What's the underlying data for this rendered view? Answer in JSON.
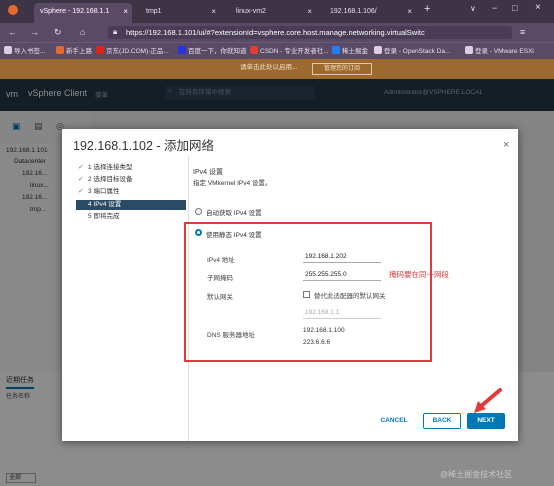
{
  "browser": {
    "tabs": [
      {
        "label": "vSphere - 192.168.1.1"
      },
      {
        "label": "tmp1"
      },
      {
        "label": "linux-vm2"
      },
      {
        "label": "192.168.1.106/"
      }
    ],
    "new_tab": "+",
    "url": "https://192.168.1.101/ui/#?extensionId=vsphere.core.host.manage.networking.virtualSwitc",
    "bookmarks": [
      {
        "label": "导入书签..."
      },
      {
        "label": "新手上路"
      },
      {
        "label": "京东(JD.COM)-正品..."
      },
      {
        "label": "百度一下，你就知道"
      },
      {
        "label": "CSDN - 专业开发者社..."
      },
      {
        "label": "稀土掘金"
      },
      {
        "label": "登录 - OpenStack Da..."
      },
      {
        "label": "登录 - VMware ESXi"
      }
    ],
    "notice_text": "请单击此处以启用...",
    "notice_button": "管理您的订阅"
  },
  "vsphere": {
    "product": "vSphere Client",
    "menu": "菜单",
    "search_placeholder": "在所有环境中搜索",
    "user": "Administrator@VSPHERE.LOCAL",
    "tree": [
      "192.168.1.101",
      "Datacenter",
      "192.16...",
      "linux...",
      "192.16...",
      "tmp..."
    ],
    "recent_tab": "近期任务",
    "recent_column": "任务名称",
    "filter": "全部"
  },
  "dialog": {
    "title": "192.168.1.102 - 添加网络",
    "steps": [
      {
        "num": "1",
        "label": "选择连接类型",
        "done": true
      },
      {
        "num": "2",
        "label": "选择目标设备",
        "done": true
      },
      {
        "num": "3",
        "label": "端口属性",
        "done": true
      },
      {
        "num": "4",
        "label": "IPv4 设置",
        "done": false,
        "current": true
      },
      {
        "num": "5",
        "label": "即将完成",
        "done": false
      }
    ],
    "section_title": "IPv4 设置",
    "section_sub": "指定 VMkernel IPv4 设置。",
    "radio_auto": "自动获取 IPv4 设置",
    "radio_static": "使用静态 IPv4 设置",
    "fields": {
      "ipv4_label": "IPv4 地址",
      "ipv4_value": "192.168.1.202",
      "mask_label": "子网掩码",
      "mask_value": "255.255.255.0",
      "gw_label": "默认网关",
      "gw_override": "替代此适配器的默认网关",
      "gw_value": "192.168.1.1",
      "dns_label": "DNS 服务器地址",
      "dns_values": [
        "192.168.1.100",
        "223.6.6.6"
      ]
    },
    "annotation": "掩码要在同一网段",
    "buttons": {
      "cancel": "CANCEL",
      "back": "BACK",
      "next": "NEXT"
    }
  },
  "watermark": "@稀土掘金技术社区",
  "colors": {
    "accent": "#0079b8",
    "annotation": "#e03a3a",
    "header": "#253746",
    "step_current": "#2b4a66"
  }
}
